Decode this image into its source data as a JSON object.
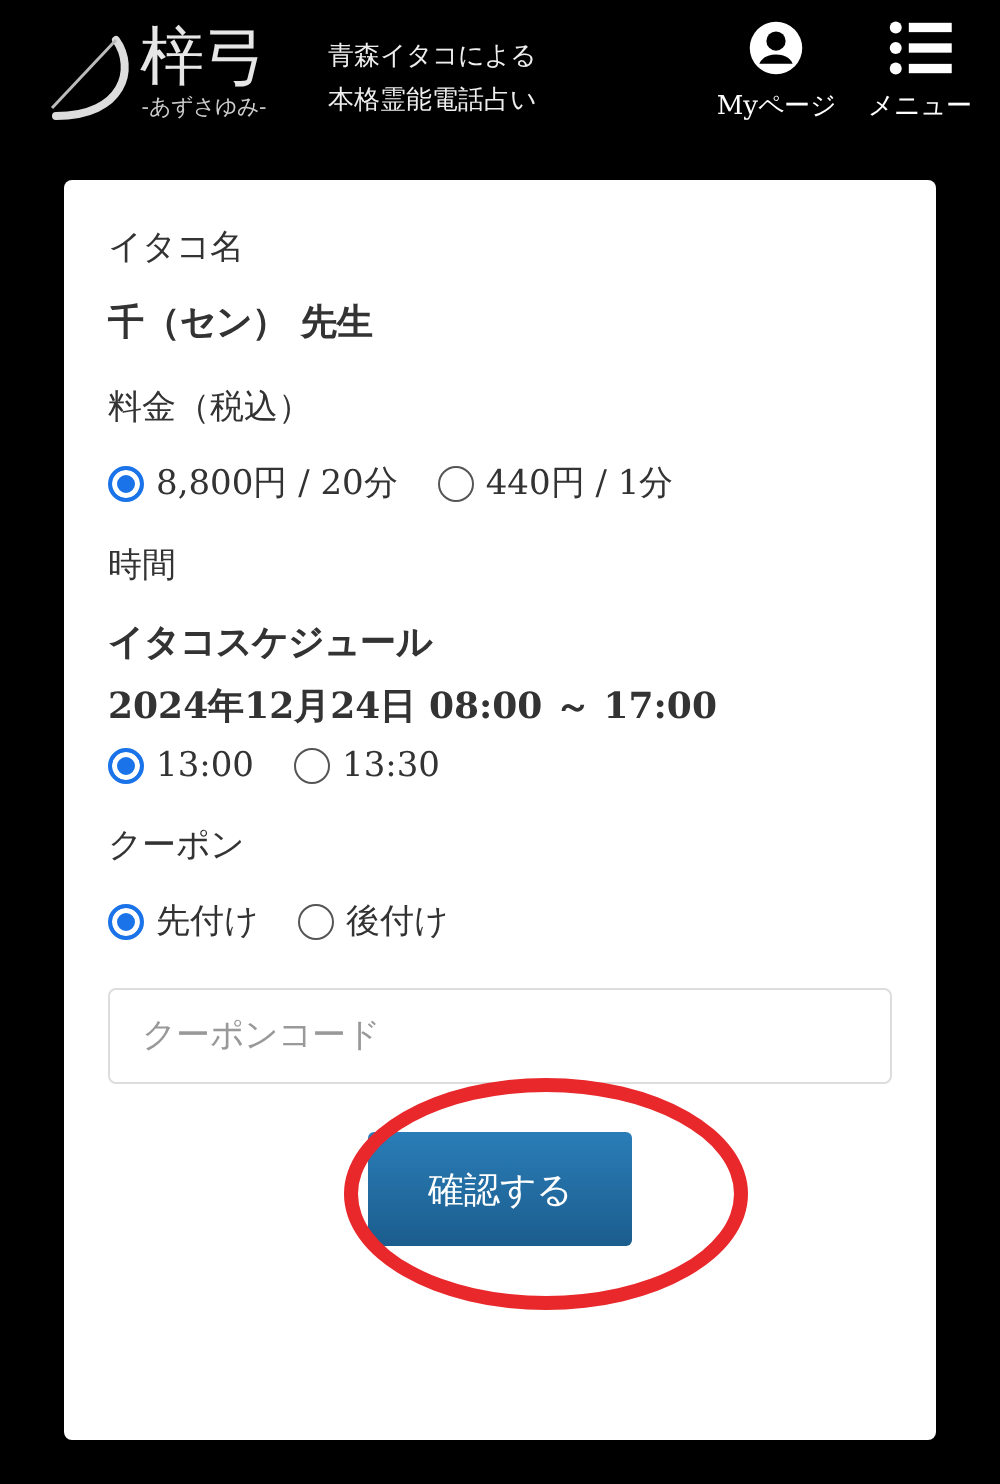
{
  "header": {
    "logo_title": "梓弓",
    "logo_subtitle": "-あずさゆみ-",
    "tagline": [
      "青森イタコによる",
      "本格霊能電話占い"
    ],
    "nav": [
      {
        "kind": "user",
        "label": "Myページ"
      },
      {
        "kind": "menu",
        "label": "メニュー"
      }
    ]
  },
  "form": {
    "sections": [
      {
        "kind": "text",
        "label": "イタコ名",
        "value": "千（セン） 先生"
      },
      {
        "kind": "radio",
        "label": "料金（税込）",
        "options": [
          {
            "label": "8,800円 / 20分",
            "selected": true
          },
          {
            "label": "440円 / 1分",
            "selected": false
          }
        ]
      },
      {
        "kind": "schedule",
        "label": "時間",
        "title": "イタコスケジュール",
        "range": "2024年12月24日 08:00 ～ 17:00",
        "options": [
          {
            "label": "13:00",
            "selected": true
          },
          {
            "label": "13:30",
            "selected": false
          }
        ]
      },
      {
        "kind": "radio",
        "label": "クーポン",
        "options": [
          {
            "label": "先付け",
            "selected": true
          },
          {
            "label": "後付け",
            "selected": false
          }
        ]
      },
      {
        "kind": "input",
        "placeholder": "クーポンコード"
      }
    ],
    "submit": {
      "label": "確認する",
      "highlighted": true
    }
  }
}
